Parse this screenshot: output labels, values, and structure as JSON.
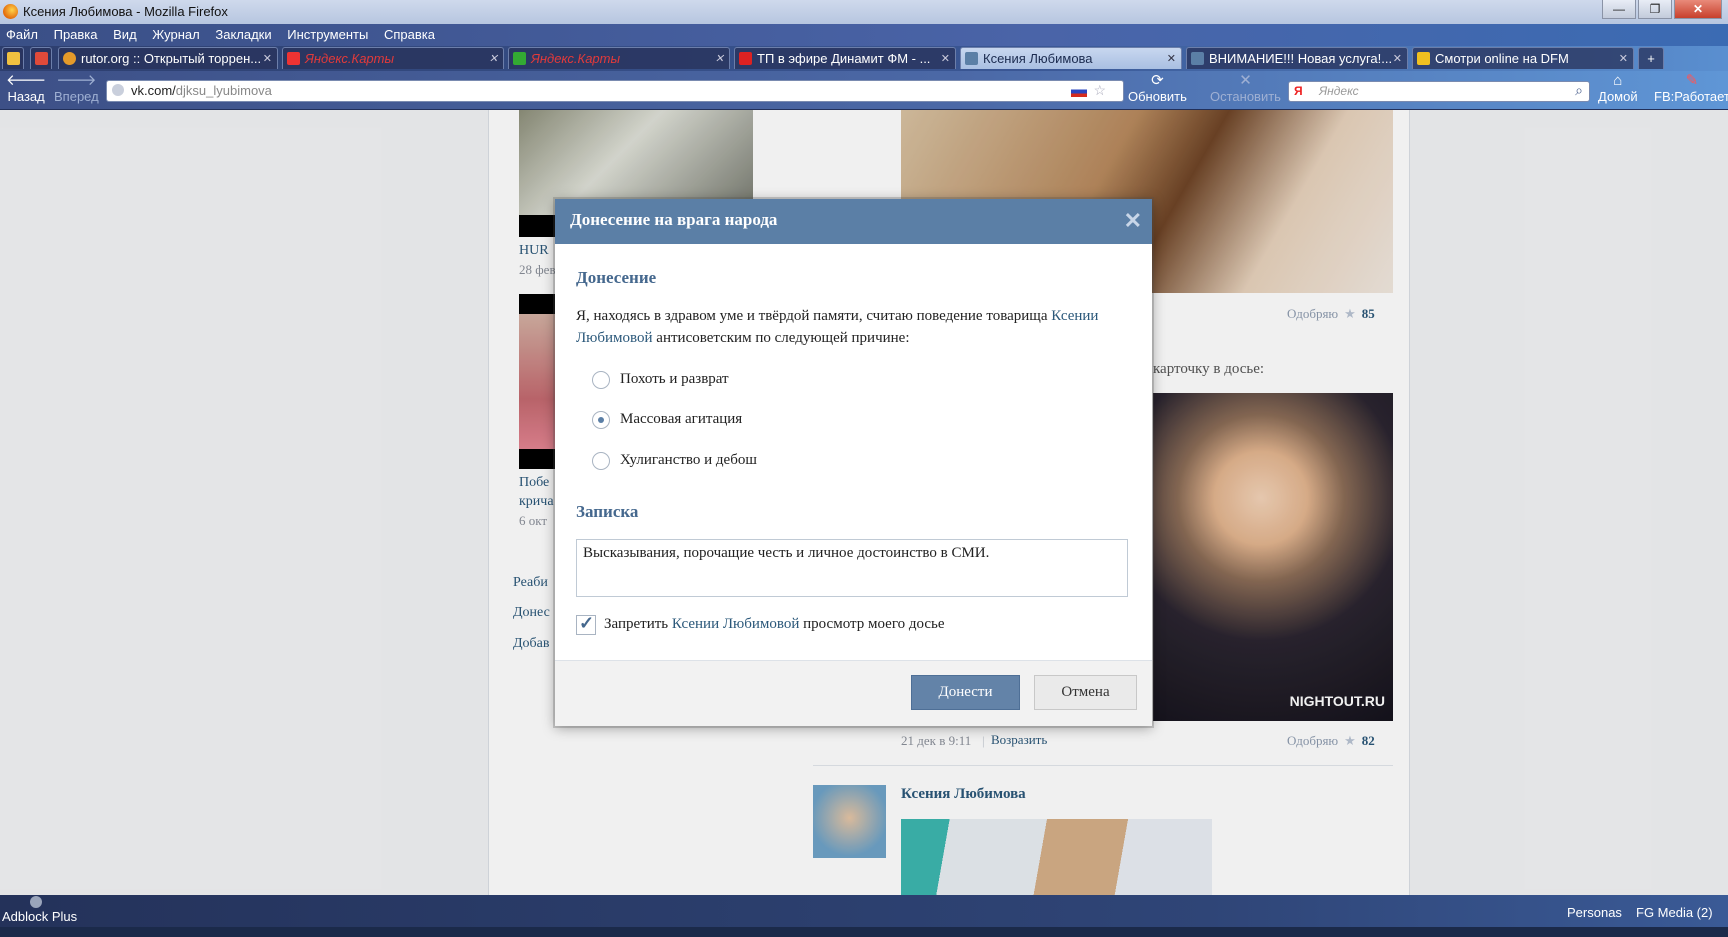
{
  "window": {
    "title": "Ксения Любимова - Mozilla Firefox",
    "minimize": "—",
    "maximize": "❐",
    "close": "✕"
  },
  "menu": [
    "Файл",
    "Правка",
    "Вид",
    "Журнал",
    "Закладки",
    "Инструменты",
    "Справка"
  ],
  "tabs": [
    {
      "label": "rutor.org :: Открытый торрен..."
    },
    {
      "label": "Яндекс.Карты"
    },
    {
      "label": "Яндекс.Карты"
    },
    {
      "label": "ТП в эфире Динамит ФМ - ..."
    },
    {
      "label": "Ксения Любимова"
    },
    {
      "label": "ВНИМАНИЕ!!! Новая услуга!..."
    },
    {
      "label": "Смотри online на DFM"
    }
  ],
  "nav": {
    "back": "Назад",
    "forward": "Вперед",
    "url_host": "vk.com/",
    "url_path": "djksu_lyubimova",
    "reload": "Обновить",
    "stop": "Остановить",
    "search_engine": "Я",
    "search_placeholder": "Яндекс",
    "home": "Домой",
    "fb": "FB:Работает"
  },
  "page": {
    "left_caption_1": "HUR",
    "left_date_1": "28 фев",
    "left_caption_2a": "Побе",
    "left_caption_2b": "крича",
    "left_date_2": "6 окт",
    "left_link_1": "Реаби",
    "left_link_2": "Донес",
    "left_link_3": "Добав",
    "approve_label_1": "Одобряю",
    "approve_count_1": "85",
    "card_text": "карточку в досье:",
    "photo_watermark": "NIGHTOUT.RU",
    "post_date": "21 дек в 9:11",
    "reply_link": "Возразить",
    "approve_label_2": "Одобряю",
    "approve_count_2": "82",
    "author_name": "Ксения Любимова"
  },
  "dialog": {
    "title": "Донесение на врага народа",
    "section_report": "Донесение",
    "text_before": "Я, находясь в здравом уме и твёрдой памяти, считаю поведение товарища",
    "text_link": "Ксении Любимовой",
    "text_after": "антисоветским по следующей причине:",
    "reasons": [
      {
        "label": "Похоть и разврат",
        "selected": false
      },
      {
        "label": "Массовая агитация",
        "selected": true
      },
      {
        "label": "Хулиганство и дебош",
        "selected": false
      }
    ],
    "section_note": "Записка",
    "note_value": "Высказывания, порочащие честь и личное достоинство в СМИ.",
    "checkbox_before": "Запретить",
    "checkbox_link": "Ксении Любимовой",
    "checkbox_after": "просмотр моего досье",
    "checkbox_checked": true,
    "submit": "Донести",
    "cancel": "Отмена"
  },
  "addon_bar": {
    "adblock": "Adblock Plus",
    "personas": "Personas",
    "fgmedia": "FG Media (2)"
  },
  "colors": {
    "vk_header": "#5b7fa6",
    "vk_link": "#2b587a",
    "vk_button": "#6383a8"
  }
}
